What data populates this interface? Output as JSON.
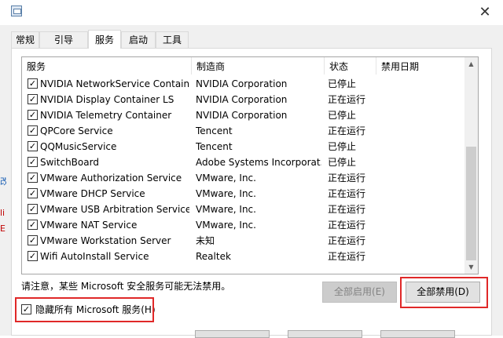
{
  "window": {
    "close_glyph": "✕",
    "app_icon": "msconfig-icon"
  },
  "tabs": [
    {
      "label": "常规",
      "active": false
    },
    {
      "label": "引导",
      "active": false
    },
    {
      "label": "服务",
      "active": true
    },
    {
      "label": "启动",
      "active": false
    },
    {
      "label": "工具",
      "active": false
    }
  ],
  "columns": {
    "service": "服务",
    "manufacturer": "制造商",
    "status": "状态",
    "disabled_date": "禁用日期"
  },
  "services": [
    {
      "checked": true,
      "name": "NVIDIA NetworkService Container",
      "manufacturer": "NVIDIA Corporation",
      "status": "已停止",
      "date": ""
    },
    {
      "checked": true,
      "name": "NVIDIA Display Container LS",
      "manufacturer": "NVIDIA Corporation",
      "status": "正在运行",
      "date": ""
    },
    {
      "checked": true,
      "name": "NVIDIA Telemetry Container",
      "manufacturer": "NVIDIA Corporation",
      "status": "已停止",
      "date": ""
    },
    {
      "checked": true,
      "name": "QPCore Service",
      "manufacturer": "Tencent",
      "status": "正在运行",
      "date": ""
    },
    {
      "checked": true,
      "name": "QQMusicService",
      "manufacturer": "Tencent",
      "status": "已停止",
      "date": ""
    },
    {
      "checked": true,
      "name": "SwitchBoard",
      "manufacturer": "Adobe Systems Incorporat...",
      "status": "已停止",
      "date": ""
    },
    {
      "checked": true,
      "name": "VMware Authorization Service",
      "manufacturer": "VMware, Inc.",
      "status": "正在运行",
      "date": ""
    },
    {
      "checked": true,
      "name": "VMware DHCP Service",
      "manufacturer": "VMware, Inc.",
      "status": "正在运行",
      "date": ""
    },
    {
      "checked": true,
      "name": "VMware USB Arbitration Service",
      "manufacturer": "VMware, Inc.",
      "status": "正在运行",
      "date": ""
    },
    {
      "checked": true,
      "name": "VMware NAT Service",
      "manufacturer": "VMware, Inc.",
      "status": "正在运行",
      "date": ""
    },
    {
      "checked": true,
      "name": "VMware Workstation Server",
      "manufacturer": "未知",
      "status": "正在运行",
      "date": ""
    },
    {
      "checked": true,
      "name": "Wifi AutoInstall Service",
      "manufacturer": "Realtek",
      "status": "正在运行",
      "date": ""
    }
  ],
  "scrollbar": {
    "up_glyph": "▲",
    "down_glyph": "▼"
  },
  "note": "请注意，某些 Microsoft 安全服务可能无法禁用。",
  "buttons": {
    "enable_all": "全部启用(E)",
    "disable_all": "全部禁用(D)"
  },
  "hide_ms": {
    "checked": true,
    "label": "隐藏所有 Microsoft 服务(H)"
  },
  "left_edge": [
    "改",
    "li",
    "E"
  ],
  "colors": {
    "highlight_box": "#e02828",
    "window_bg": "#f0f0f0"
  }
}
